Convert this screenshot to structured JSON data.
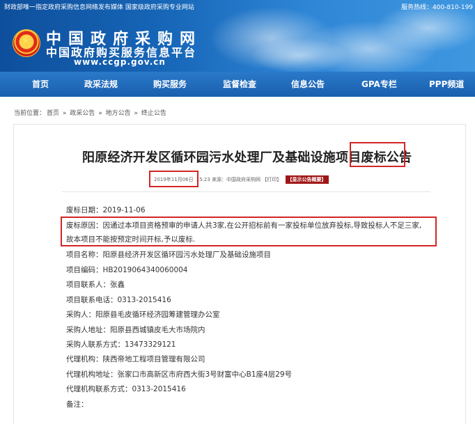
{
  "banner": {
    "top_left": "财政部唯一指定政府采购信息网络发布媒体 国家级政府采购专业网站",
    "top_right": "服务热线：400-810-199",
    "logo_line1": "中国政府采购网",
    "logo_line2": "中国政府购买服务信息平台",
    "logo_url": "www.ccgp.gov.cn"
  },
  "nav": {
    "items": [
      "首页",
      "政采法规",
      "购买服务",
      "监督检查",
      "信息公告",
      "GPA专栏",
      "PPP频道"
    ]
  },
  "breadcrumb": {
    "label": "当前位置：",
    "items": [
      "首页",
      "政采公告",
      "地方公告",
      "终止公告"
    ],
    "separator": "»"
  },
  "article": {
    "title_main": "阳原经济开发区循环园污水处理厂及基础设施项目",
    "title_highlight": "废标公告",
    "meta": {
      "date": "2019年11月06日",
      "time": "15:23",
      "source": "来源：中国政府采购网",
      "print": "【打印】",
      "summary_button": "【显示公告概要】"
    },
    "fields": [
      "废标日期：2019-11-06",
      "废标原因：因通过本项目资格预审的申请人共3家,在公开招标前有一家投标单位放弃投标,导致投标人不足三家,",
      "故本项目不能按预定时间开标,予以废标.",
      "项目名称：阳原县经济开发区循环园污水处理厂及基础设施项目",
      "项目编码：HB2019064340060004",
      "项目联系人：张鑫",
      "项目联系电话：0313-2015416",
      "采购人：阳原县毛皮循环经济园筹建管理办公室",
      "采购人地址：阳原县西城镇皮毛大市场院内",
      "采购人联系方式：13473329121",
      "代理机构：陕西帝地工程项目管理有限公司",
      "代理机构地址：张家口市高新区市府西大街3号财富中心B1座4层29号",
      "代理机构联系方式：0313-2015416",
      "备注："
    ]
  },
  "colors": {
    "nav_bg": "#1a5fae",
    "highlight_box": "#d32525",
    "badge": "#a01616"
  }
}
